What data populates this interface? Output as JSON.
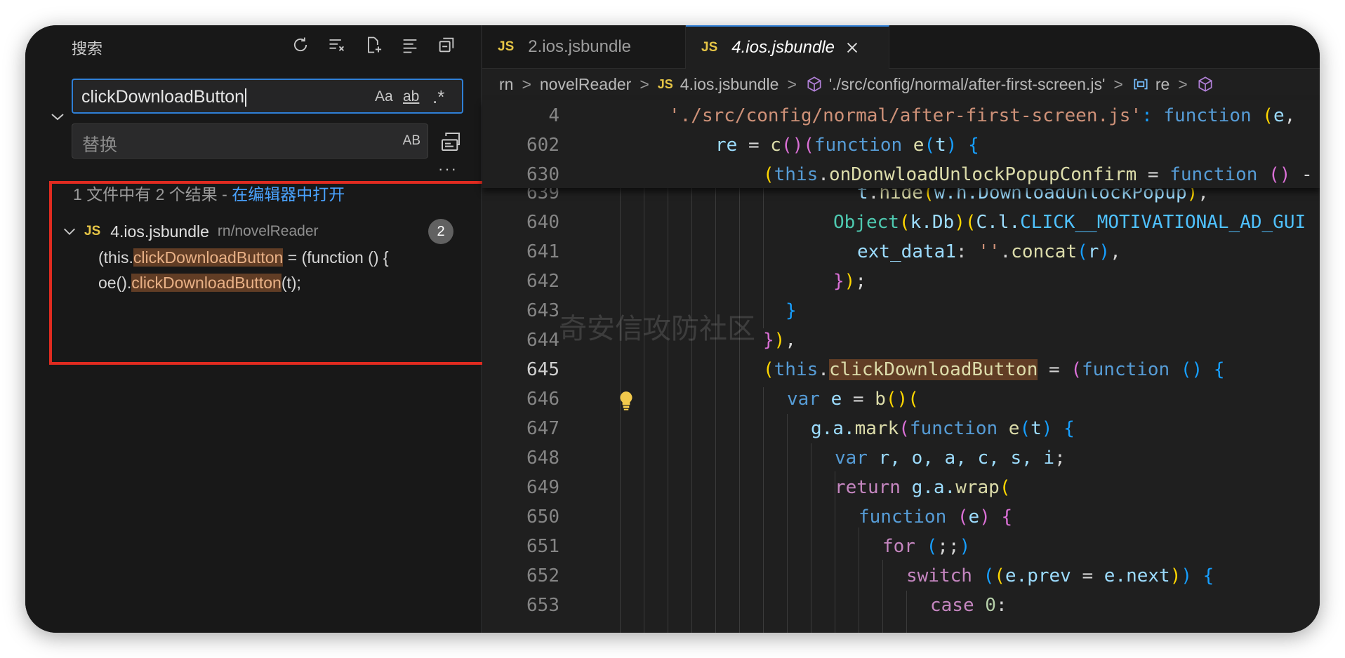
{
  "search_panel": {
    "title": "搜索",
    "search_value": "clickDownloadButton",
    "opt_case": "Aa",
    "opt_word": "ab",
    "opt_regex": ".*",
    "replace_placeholder": "替换",
    "replace_opt": "AB",
    "more": "···",
    "summary_prefix": "1 文件中有 2 个结果 - ",
    "summary_link": "在编辑器中打开",
    "file": {
      "lang": "JS",
      "name": "4.ios.jsbundle",
      "path": "rn/novelReader",
      "count": "2"
    },
    "matches": [
      {
        "pre": "(this.",
        "hit": "clickDownloadButton",
        "post": " = (function () {"
      },
      {
        "pre": "oe().",
        "hit": "clickDownloadButton",
        "post": "(t);"
      }
    ]
  },
  "tabs": [
    {
      "lang": "JS",
      "label": "2.ios.jsbundle"
    },
    {
      "lang": "JS",
      "label": "4.ios.jsbundle"
    }
  ],
  "breadcrumb": {
    "c1": "rn",
    "c2": "novelReader",
    "c3_lang": "JS",
    "c3": "4.ios.jsbundle",
    "c4": "'./src/config/normal/after-first-screen.js'",
    "c5": "re"
  },
  "line_numbers": {
    "s1": "4",
    "s2": "602",
    "s3": "630",
    "l639": "639",
    "l640": "640",
    "l641": "641",
    "l642": "642",
    "l643": "643",
    "l644": "644",
    "l645": "645",
    "l646": "646",
    "l647": "647",
    "l648": "648",
    "l649": "649",
    "l650": "650",
    "l651": "651",
    "l652": "652",
    "l653": "653"
  },
  "code_tokens": {
    "path": "'./src/config/normal/after-first-screen.js'",
    "function": "function",
    "e": "e",
    "t": "t",
    "re": "re",
    "c": "c",
    "this": "this",
    "onDonwloadUnlockPopupConfirm": "onDonwloadUnlockPopupConfirm",
    "hide": "hide",
    "w_h_DownloadUnlockPopup": "w.h.DownloadUnlockPopup",
    "Object": "Object",
    "k_Db": "k.Db",
    "C_l": "C.l.",
    "CLICK_const": "CLICK__MOTIVATIONAL_AD_GUI",
    "ext_data1": "ext_data1",
    "empty_str": "''",
    "concat": "concat",
    "r": "r",
    "clickDownloadButton": "clickDownloadButton",
    "var": "var",
    "b": "b",
    "g_a": "g.a.",
    "mark": "mark",
    "vars": "r, o, a, c, s, i",
    "return": "return",
    "wrap": "wrap",
    "for": "for",
    "semis": ";;",
    "switch": "switch",
    "e_prev": "e.prev",
    "e_next": "e.next",
    "case": "case",
    "zero": "0"
  },
  "watermark": "奇安信攻防社区",
  "colors": {
    "accent": "#2f7fd6",
    "match_highlight": "#613d25",
    "annotation_box": "#e02b20",
    "js_badge": "#e6c546"
  }
}
